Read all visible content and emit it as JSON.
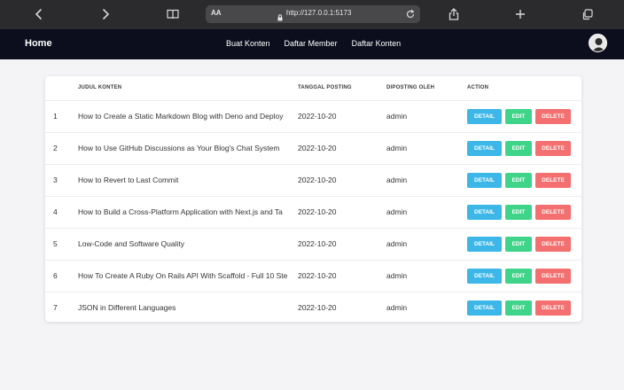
{
  "browser": {
    "aa_label": "AA",
    "url": "http://127.0.0.1:5173"
  },
  "navbar": {
    "brand": "Home",
    "links": [
      "Buat Konten",
      "Daftar Member",
      "Daftar Konten"
    ]
  },
  "table": {
    "headers": {
      "title": "JUDUL KONTEN",
      "date": "TANGGAL POSTING",
      "author": "DIPOSTING OLEH",
      "action": "ACTION"
    },
    "rows": [
      {
        "no": "1",
        "title": "How to Create a Static Markdown Blog with Deno and Deploy",
        "date": "2022-10-20",
        "author": "admin"
      },
      {
        "no": "2",
        "title": "How to Use GitHub Discussions as Your Blog's Chat System",
        "date": "2022-10-20",
        "author": "admin"
      },
      {
        "no": "3",
        "title": "How to Revert to Last Commit",
        "date": "2022-10-20",
        "author": "admin"
      },
      {
        "no": "4",
        "title": "How to Build a Cross-Platform Application with Next.js and Ta",
        "date": "2022-10-20",
        "author": "admin"
      },
      {
        "no": "5",
        "title": "Low-Code and Software Quality",
        "date": "2022-10-20",
        "author": "admin"
      },
      {
        "no": "6",
        "title": "How To Create A Ruby On Rails API With Scaffold - Full 10 Ste",
        "date": "2022-10-20",
        "author": "admin"
      },
      {
        "no": "7",
        "title": "JSON in Different Languages",
        "date": "2022-10-20",
        "author": "admin"
      }
    ],
    "actions": {
      "detail": "DETAIL",
      "edit": "EDIT",
      "delete": "DELETE"
    }
  },
  "colors": {
    "navbar_bg": "#0c0d1d",
    "detail": "#3cb7e7",
    "edit": "#3fd48a",
    "delete": "#f46f6f"
  }
}
